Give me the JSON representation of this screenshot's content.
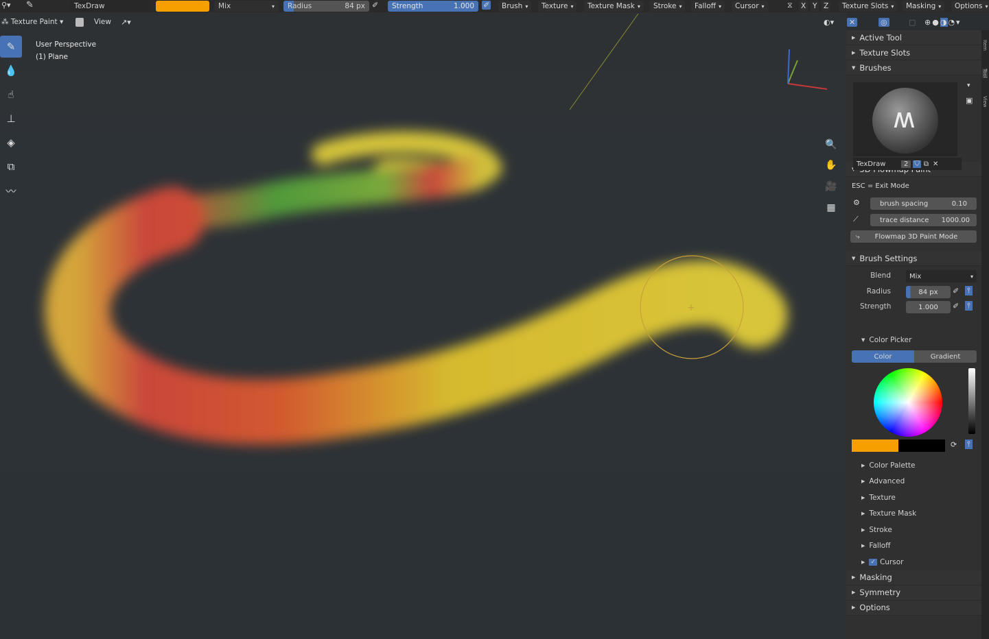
{
  "topbar": {
    "brush_name": "TexDraw",
    "color": "#f5a000",
    "blend": "Mix",
    "radius_label": "Radius",
    "radius_value": "84 px",
    "strength_label": "Strength",
    "strength_value": "1.000",
    "menus": [
      "Brush",
      "Texture",
      "Texture Mask",
      "Stroke",
      "Falloff",
      "Cursor"
    ],
    "axes": [
      "X",
      "Y",
      "Z"
    ],
    "right_menus": [
      "Texture Slots",
      "Masking",
      "Options"
    ]
  },
  "header": {
    "mode": "Texture Paint",
    "view": "View"
  },
  "viewport": {
    "perspective": "User Perspective",
    "object": "(1) Plane"
  },
  "panel": {
    "active_tool": "Active Tool",
    "texture_slots": "Texture Slots",
    "brushes": "Brushes",
    "brush_name": "TexDraw",
    "brush_users": "2",
    "flowmap": {
      "title": "3D Flowmap Paint",
      "hint": "ESC = Exit Mode",
      "spacing_label": "brush spacing",
      "spacing_value": "0.10",
      "trace_label": "trace distance",
      "trace_value": "1000.00",
      "mode_button": "Flowmap 3D Paint Mode"
    },
    "brush_settings": {
      "title": "Brush Settings",
      "blend_label": "Blend",
      "blend_value": "Mix",
      "radius_label": "Radius",
      "radius_value": "84 px",
      "radius_fraction": 0.08,
      "strength_label": "Strength",
      "strength_value": "1.000",
      "strength_fraction": 1.0
    },
    "color_picker": {
      "title": "Color Picker",
      "tab_color": "Color",
      "tab_gradient": "Gradient",
      "primary": "#f5a000",
      "secondary": "#000000"
    },
    "subsections": [
      "Color Palette",
      "Advanced",
      "Texture",
      "Texture Mask",
      "Stroke",
      "Falloff",
      "Cursor"
    ],
    "sections": [
      "Masking",
      "Symmetry",
      "Options"
    ]
  },
  "side_tabs": [
    "Item",
    "Tool",
    "View"
  ]
}
